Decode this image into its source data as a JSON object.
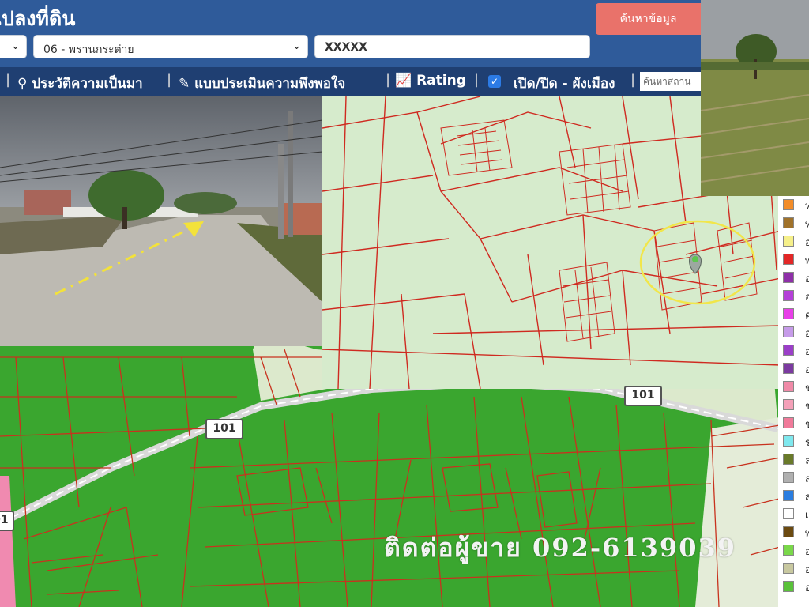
{
  "header": {
    "title": "แปลงที่ดิน"
  },
  "filters": {
    "district_select": "06 - พรานกระต่าย",
    "keyword_value": "XXXXX",
    "search_button": "ค้นหาข้อมูล"
  },
  "nav": {
    "history": "ประวัติความเป็นมา",
    "survey": "แบบประเมินความพึงพอใจ",
    "rating": "Rating",
    "toggle_layer": "เปิด/ปิด - ผังเมือง",
    "map_search_placeholder": "ค้นหาสถาน"
  },
  "map": {
    "road_number": "101",
    "seller_contact": "ติดต่อผู้ขาย 092-6139039"
  },
  "legend": {
    "items": [
      {
        "color": "#f28c28",
        "label": "ท"
      },
      {
        "color": "#a0722a",
        "label": "ท"
      },
      {
        "color": "#f6f08a",
        "label": "อ"
      },
      {
        "color": "#e32727",
        "label": "พ"
      },
      {
        "color": "#8e2fa8",
        "label": "อ"
      },
      {
        "color": "#b43fd8",
        "label": "อ"
      },
      {
        "color": "#e83fe8",
        "label": "ค"
      },
      {
        "color": "#c69be9",
        "label": "อ"
      },
      {
        "color": "#9b3fc8",
        "label": "อ"
      },
      {
        "color": "#7b3aa0",
        "label": "อ"
      },
      {
        "color": "#f08aa8",
        "label": "ช"
      },
      {
        "color": "#f4a0b8",
        "label": "ช"
      },
      {
        "color": "#f07a9a",
        "label": "ช"
      },
      {
        "color": "#7fe8ee",
        "label": "ร"
      },
      {
        "color": "#6a7a2a",
        "label": "ล"
      },
      {
        "color": "#b0b0b0",
        "label": "ส"
      },
      {
        "color": "#2a7de0",
        "label": "ส"
      },
      {
        "color": "#ffffff",
        "label": "เ"
      },
      {
        "color": "#6b4a10",
        "label": "พ"
      },
      {
        "color": "#7ad84a",
        "label": "อ"
      },
      {
        "color": "#c8c8a0",
        "label": "อ"
      },
      {
        "color": "#5ac23a",
        "label": "อ"
      }
    ]
  }
}
